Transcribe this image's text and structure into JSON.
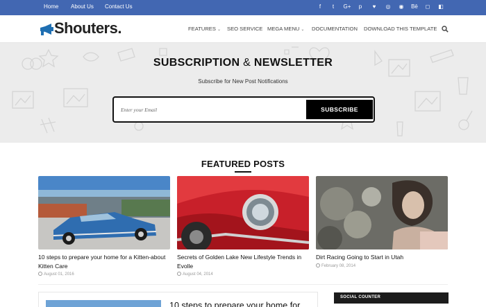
{
  "topbar": {
    "links": [
      "Home",
      "About Us",
      "Contact Us"
    ],
    "social_icons": [
      "facebook-icon",
      "twitter-icon",
      "google-plus-icon",
      "pinterest-icon",
      "heart-icon",
      "dribbble-icon",
      "rss-icon",
      "behance-icon",
      "instagram-icon",
      "delicious-icon"
    ],
    "social_glyphs": [
      "f",
      "t",
      "G+",
      "p",
      "♥",
      "◎",
      "◉",
      "Bē",
      "◻",
      "◧"
    ]
  },
  "header": {
    "logo_text": "Shouters.",
    "nav": [
      {
        "label": "FEATURES",
        "has_caret": true
      },
      {
        "label": "SEO SERVICE",
        "has_caret": false
      },
      {
        "label": "MEGA MENU",
        "has_caret": true
      },
      {
        "label": "DOCUMENTATION",
        "has_caret": false
      },
      {
        "label": "DOWNLOAD THIS TEMPLATE",
        "has_caret": false
      }
    ]
  },
  "subscribe": {
    "title_a": "SUBSCRIPTION",
    "title_amp": "&",
    "title_b": "NEWSLETTER",
    "subtitle": "Subscribe for New Post Notifications",
    "email_placeholder": "Enter your Email",
    "button_label": "SUBSCRIBE"
  },
  "featured": {
    "heading": "FEATURED POSTS",
    "posts": [
      {
        "title": "10 steps to prepare your home for a Kitten-about Kitten Care",
        "date": "August 01, 2016"
      },
      {
        "title": "Secrets of Golden Lake New Lifestyle Trends in Evolle",
        "date": "August 04, 2014"
      },
      {
        "title": "Dirt Racing Going to Start in Utah",
        "date": "February 08, 2014"
      }
    ]
  },
  "lower": {
    "card_title": "10 steps to prepare your home for",
    "social_counter_label": "SOCIAL COUNTER"
  },
  "colors": {
    "topbar": "#4267b2",
    "band": "#ececec",
    "button": "#000000"
  }
}
